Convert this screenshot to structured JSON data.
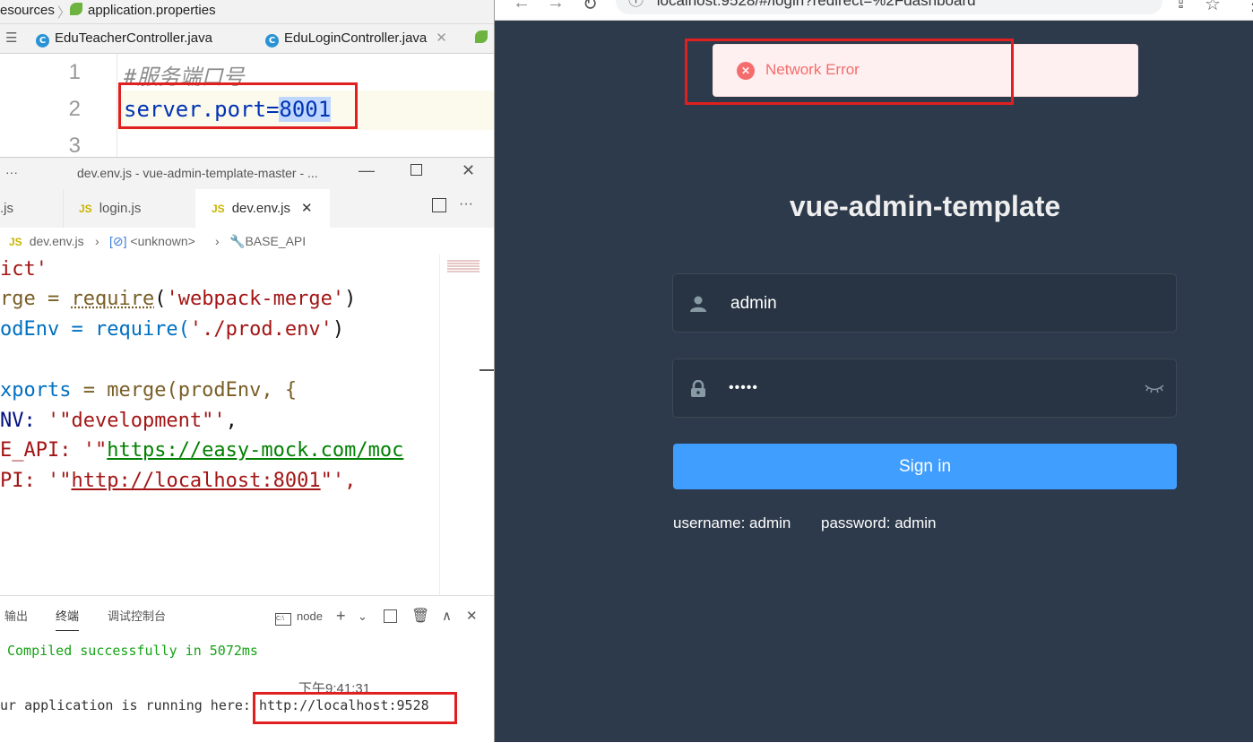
{
  "ide": {
    "breadcrumb": {
      "folder": "esources",
      "file": "application.properties"
    },
    "tabs": [
      "EduTeacherController.java",
      "EduLoginController.java"
    ],
    "line_numbers": [
      "1",
      "2",
      "3"
    ],
    "code": {
      "comment": "#服务端口号",
      "key": "server.port=",
      "value": "8001"
    }
  },
  "vscode": {
    "title": "dev.env.js - vue-admin-template-master - ...",
    "menu_dots": "···",
    "tabs": [
      {
        "icon": "JS",
        "label": ".js"
      },
      {
        "icon": "JS",
        "label": "login.js"
      },
      {
        "icon": "JS",
        "label": "dev.env.js",
        "close": "✕"
      }
    ],
    "breadcrumb": [
      "dev.env.js",
      "<unknown>",
      "BASE_API"
    ],
    "code": {
      "l1": "ict'",
      "l2_a": "rge = ",
      "l2_b": "require",
      "l2_c": "(",
      "l2_d": "'webpack-merge'",
      "l2_e": ")",
      "l3_a": "odEnv = require(",
      "l3_b": "'./prod.env'",
      "l3_c": ")",
      "l5_a": "xports",
      "l5_b": " = merge(prodEnv, {",
      "l6_a": "NV: ",
      "l6_b": "'\"development\"'",
      "l6_c": ",",
      "l7_a": "E_API: '\"",
      "l7_b": "https://easy-mock.com/moc",
      "l8_a": "PI: '\"",
      "l8_b": "http://localhost:8001",
      "l8_c": "\"',"
    },
    "panel": {
      "tabs": [
        "输出",
        "终端",
        "调试控制台"
      ],
      "terminal_select": "node",
      "compiled": "Compiled successfully in 5072ms",
      "time": "下午9:41:31",
      "running_prefix": "ur application is running here: ",
      "running_url": "http://localhost:9528"
    }
  },
  "browser": {
    "url": "localhost:9528/#/login?redirect=%2Fdashboard",
    "alert": "Network Error",
    "title": "vue-admin-template",
    "username_value": "admin",
    "password_value": "•••••",
    "signin": "Sign in",
    "tip_username": "username: admin",
    "tip_password": "password: admin"
  },
  "colors": {
    "bg": "#2d3a4b",
    "primary": "#409eff",
    "error": "#f56c6c",
    "highlight": "#e02020"
  }
}
